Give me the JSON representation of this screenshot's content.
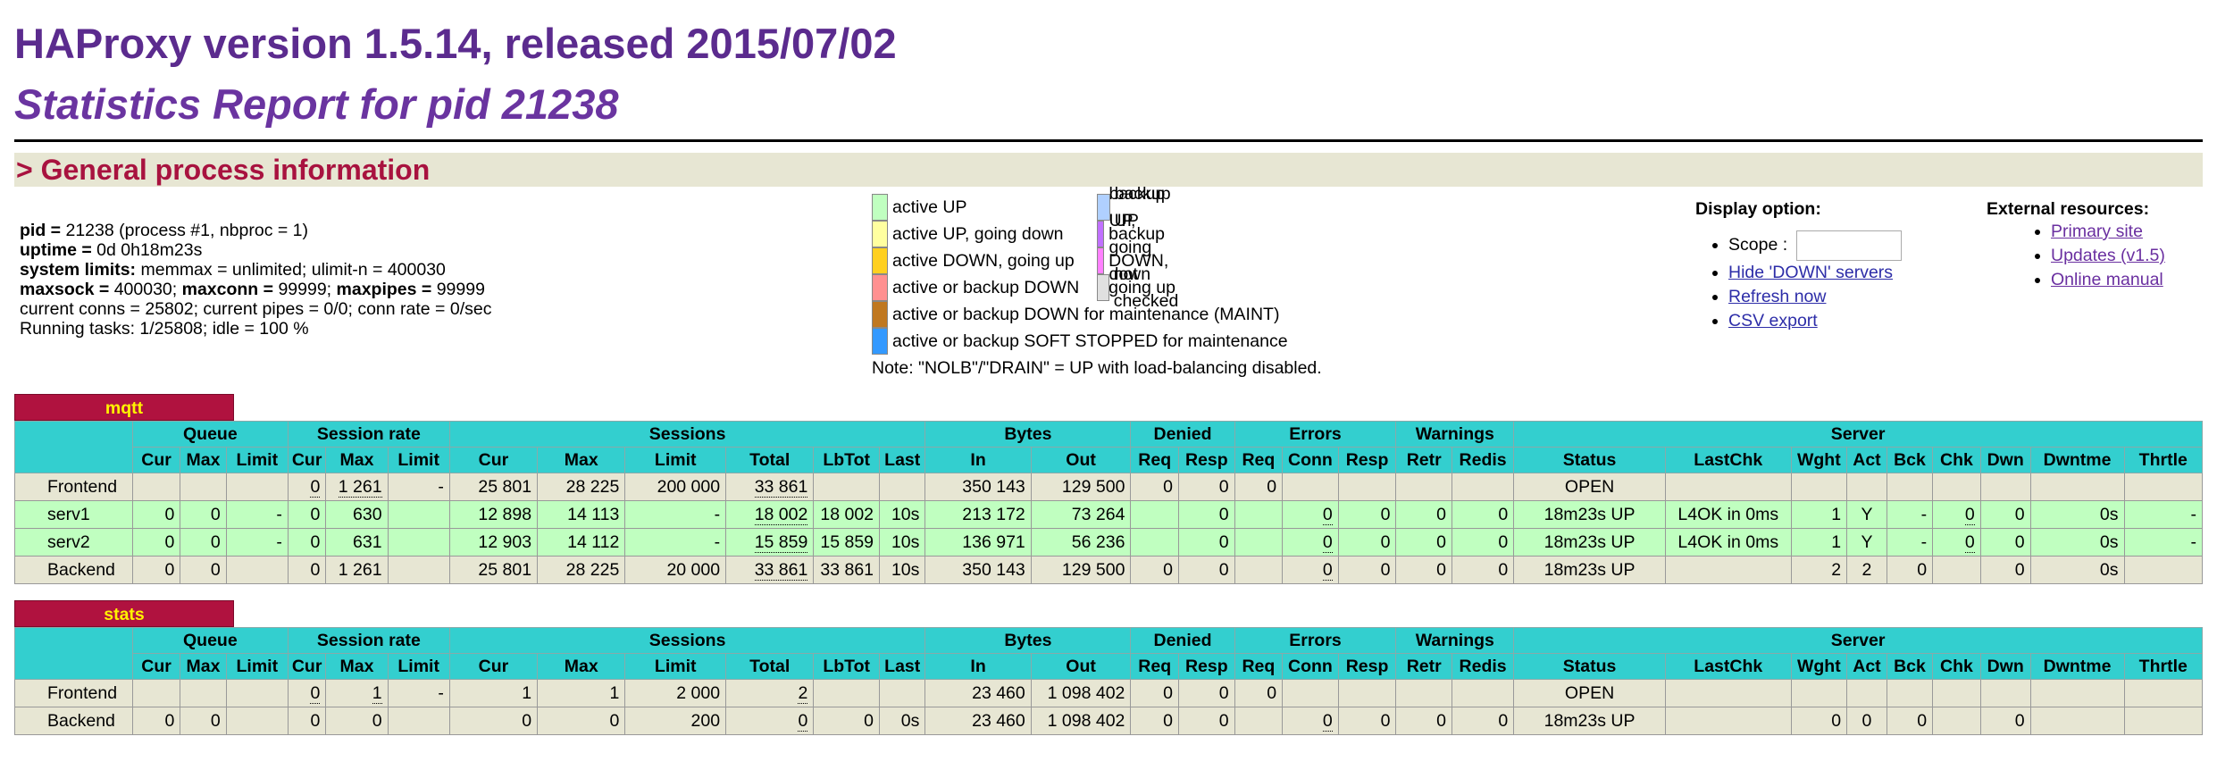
{
  "header": {
    "version": "HAProxy version 1.5.14, released 2015/07/02",
    "report_title": "Statistics Report for pid 21238"
  },
  "section": {
    "title": "> General process information"
  },
  "procinfo": {
    "pid_label": "pid = ",
    "pid_value": "21238 (process #1, nbproc = 1)",
    "uptime_label": "uptime = ",
    "uptime_value": "0d 0h18m23s",
    "syslimits_label": "system limits:",
    "syslimits_value": " memmax = unlimited; ulimit-n = 400030",
    "maxsock_label": "maxsock = ",
    "maxsock_value": "400030; ",
    "maxconn_label": "maxconn = ",
    "maxconn_value": "99999; ",
    "maxpipes_label": "maxpipes = ",
    "maxpipes_value": "99999",
    "current": "current conns = 25802; current pipes = 0/0; conn rate = 0/sec",
    "tasks": "Running tasks: 1/25808; idle = 100 %"
  },
  "legend": {
    "col1": [
      {
        "label": "active UP",
        "color": "#c0ffc0"
      },
      {
        "label": "active UP, going down",
        "color": "#ffffa0"
      },
      {
        "label": "active DOWN, going up",
        "color": "#ffd020"
      },
      {
        "label": "active or backup DOWN",
        "color": "#ff9090"
      }
    ],
    "col2": [
      {
        "label": "backup UP",
        "color": "#b0d0ff"
      },
      {
        "label": "backup UP, going down",
        "color": "#c070ff"
      },
      {
        "label": "backup DOWN, going up",
        "color": "#ff80ff"
      },
      {
        "label": "not checked",
        "color": "#e0e0e0"
      }
    ],
    "maint": {
      "label": "active or backup DOWN for maintenance (MAINT)",
      "color": "#c07820"
    },
    "soft": {
      "label": "active or backup SOFT STOPPED for maintenance",
      "color": "#3399ff"
    },
    "note": "Note: \"NOLB\"/\"DRAIN\" = UP with load-balancing disabled."
  },
  "display_option": {
    "title": "Display option:",
    "scope_label": "Scope :",
    "scope_value": "",
    "links": [
      "Hide 'DOWN' servers",
      "Refresh now",
      "CSV export"
    ]
  },
  "external": {
    "title": "External resources:",
    "links": [
      "Primary site",
      "Updates (v1.5)",
      "Online manual"
    ]
  },
  "table_headers": {
    "groups": [
      "Queue",
      "Session rate",
      "Sessions",
      "Bytes",
      "Denied",
      "Errors",
      "Warnings",
      "Server"
    ],
    "cols": [
      "Cur",
      "Max",
      "Limit",
      "Cur",
      "Max",
      "Limit",
      "Cur",
      "Max",
      "Limit",
      "Total",
      "LbTot",
      "Last",
      "In",
      "Out",
      "Req",
      "Resp",
      "Req",
      "Conn",
      "Resp",
      "Retr",
      "Redis",
      "Status",
      "LastChk",
      "Wght",
      "Act",
      "Bck",
      "Chk",
      "Dwn",
      "Dwntme",
      "Thrtle"
    ]
  },
  "proxies": [
    {
      "name": "mqtt",
      "rows": [
        {
          "type": "fe",
          "cells": [
            "Frontend",
            "",
            "",
            "",
            "0",
            "1 261",
            "-",
            "25 801",
            "28 225",
            "200 000",
            "33 861",
            "",
            "",
            "350 143",
            "129 500",
            "0",
            "0",
            "0",
            "",
            "",
            "",
            "",
            "OPEN",
            "",
            "",
            "",
            "",
            "",
            "",
            "",
            ""
          ]
        },
        {
          "type": "up",
          "cells": [
            "serv1",
            "0",
            "0",
            "-",
            "0",
            "630",
            "",
            "12 898",
            "14 113",
            "-",
            "18 002",
            "18 002",
            "10s",
            "213 172",
            "73 264",
            "",
            "0",
            "",
            "0",
            "0",
            "0",
            "0",
            "18m23s UP",
            "L4OK in 0ms",
            "1",
            "Y",
            "-",
            "0",
            "0",
            "0s",
            "-"
          ]
        },
        {
          "type": "up",
          "cells": [
            "serv2",
            "0",
            "0",
            "-",
            "0",
            "631",
            "",
            "12 903",
            "14 112",
            "-",
            "15 859",
            "15 859",
            "10s",
            "136 971",
            "56 236",
            "",
            "0",
            "",
            "0",
            "0",
            "0",
            "0",
            "18m23s UP",
            "L4OK in 0ms",
            "1",
            "Y",
            "-",
            "0",
            "0",
            "0s",
            "-"
          ]
        },
        {
          "type": "be",
          "cells": [
            "Backend",
            "0",
            "0",
            "",
            "0",
            "1 261",
            "",
            "25 801",
            "28 225",
            "20 000",
            "33 861",
            "33 861",
            "10s",
            "350 143",
            "129 500",
            "0",
            "0",
            "",
            "0",
            "0",
            "0",
            "0",
            "18m23s UP",
            "",
            "2",
            "2",
            "0",
            "",
            "0",
            "0s",
            ""
          ]
        }
      ]
    },
    {
      "name": "stats",
      "rows": [
        {
          "type": "fe",
          "cells": [
            "Frontend",
            "",
            "",
            "",
            "0",
            "1",
            "-",
            "1",
            "1",
            "2 000",
            "2",
            "",
            "",
            "23 460",
            "1 098 402",
            "0",
            "0",
            "0",
            "",
            "",
            "",
            "",
            "OPEN",
            "",
            "",
            "",
            "",
            "",
            "",
            "",
            ""
          ]
        },
        {
          "type": "be",
          "cells": [
            "Backend",
            "0",
            "0",
            "",
            "0",
            "0",
            "",
            "0",
            "0",
            "200",
            "0",
            "0",
            "0s",
            "23 460",
            "1 098 402",
            "0",
            "0",
            "",
            "0",
            "0",
            "0",
            "0",
            "18m23s UP",
            "",
            "0",
            "0",
            "0",
            "",
            "0",
            "",
            ""
          ]
        }
      ]
    }
  ]
}
